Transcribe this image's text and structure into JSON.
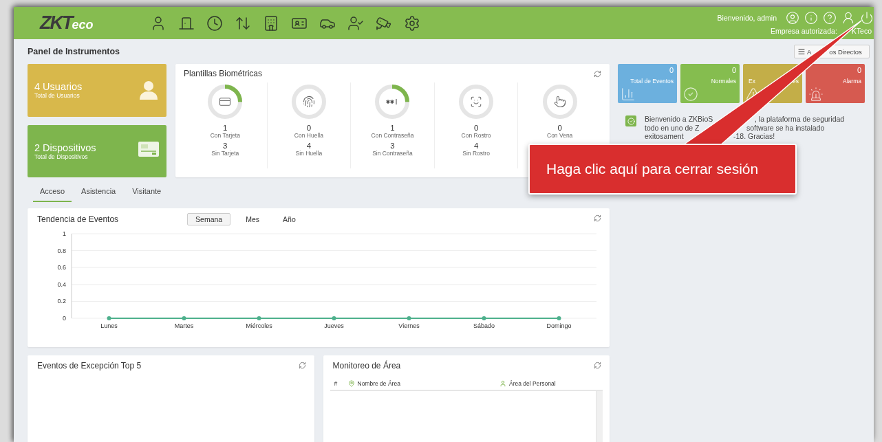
{
  "header": {
    "logo": {
      "main": "ZKT",
      "accent": "eco"
    },
    "welcome": "Bienvenido, admin",
    "company": [
      "Empresa autorizada:",
      "KTeco"
    ]
  },
  "page_title": "Panel de Instrumentos",
  "shortcut_button": [
    "A",
    "os Directos"
  ],
  "summary_cards": [
    {
      "kind": "users",
      "value": "4 Usuarios",
      "caption": "Total de Usuarios",
      "color": "#d8b84b"
    },
    {
      "kind": "devices",
      "value": "2 Dispositivos",
      "caption": "Total de Dispositivos",
      "color": "#7eb54d"
    }
  ],
  "biometrics": {
    "title": "Plantillas Biométricas",
    "items": [
      {
        "kind": "card",
        "level": 0.25,
        "with_count": "1",
        "with_label": "Con Tarjeta",
        "without_count": "3",
        "without_label": "Sin Tarjeta"
      },
      {
        "kind": "fingerprint",
        "level": 0,
        "with_count": "0",
        "with_label": "Con Huella",
        "without_count": "4",
        "without_label": "Sin Huella"
      },
      {
        "kind": "password",
        "level": 0.25,
        "with_count": "1",
        "with_label": "Con Contraseña",
        "without_count": "3",
        "without_label": "Sin Contraseña"
      },
      {
        "kind": "face",
        "level": 0,
        "with_count": "0",
        "with_label": "Con Rostro",
        "without_count": "4",
        "without_label": "Sin Rostro"
      },
      {
        "kind": "vein",
        "level": 0,
        "with_count": "0",
        "with_label": "Con Vena"
      }
    ]
  },
  "event_tiles": [
    {
      "kind": "total",
      "count": "0",
      "label": [
        "Total de Eventos"
      ],
      "color": "#6cb0de"
    },
    {
      "kind": "normal",
      "count": "0",
      "label": [
        "Normales"
      ],
      "color": "#85bd4f"
    },
    {
      "kind": "exception",
      "label": [
        "Ex",
        "es"
      ],
      "color": "#c3ae48"
    },
    {
      "kind": "alarm",
      "count": "0",
      "label": [
        "Alarma"
      ],
      "color": "#d65a50"
    }
  ],
  "notice": {
    "lines": [
      [
        "Bienvenido a ZKBioS",
        ", la plataforma de seguridad"
      ],
      [
        "todo en uno de Z",
        "software se ha instalado"
      ],
      [
        "exitosament",
        "-18. Gracias!"
      ]
    ]
  },
  "tabs": [
    {
      "label": "Acceso",
      "selected": true
    },
    {
      "label": "Asistencia",
      "selected": false
    },
    {
      "label": "Visitante",
      "selected": false
    }
  ],
  "trend": {
    "title": "Tendencia de Eventos",
    "ranges": [
      {
        "label": "Semana",
        "selected": true
      },
      {
        "label": "Mes",
        "selected": false
      },
      {
        "label": "Año",
        "selected": false
      }
    ],
    "chart_data": {
      "type": "line",
      "categories": [
        "Lunes",
        "Martes",
        "Miércoles",
        "Jueves",
        "Viernes",
        "Sábado",
        "Domingo"
      ],
      "series": [
        {
          "color": "#4db08c",
          "marker": "circle",
          "values": [
            0,
            0,
            0,
            0,
            0,
            0,
            0
          ]
        }
      ],
      "ylim": [
        0,
        1
      ],
      "yticks": [
        0,
        0.2,
        0.4,
        0.6,
        0.8,
        1
      ],
      "grid": true
    }
  },
  "exceptions": {
    "title": "Eventos de Excepción Top 5"
  },
  "area_monitor": {
    "title": "Monitoreo de Área",
    "columns": [
      "#",
      "Nombre de Área",
      "Área del Personal"
    ]
  },
  "callout": {
    "text": "Haga clic aquí para cerrar sesión"
  }
}
